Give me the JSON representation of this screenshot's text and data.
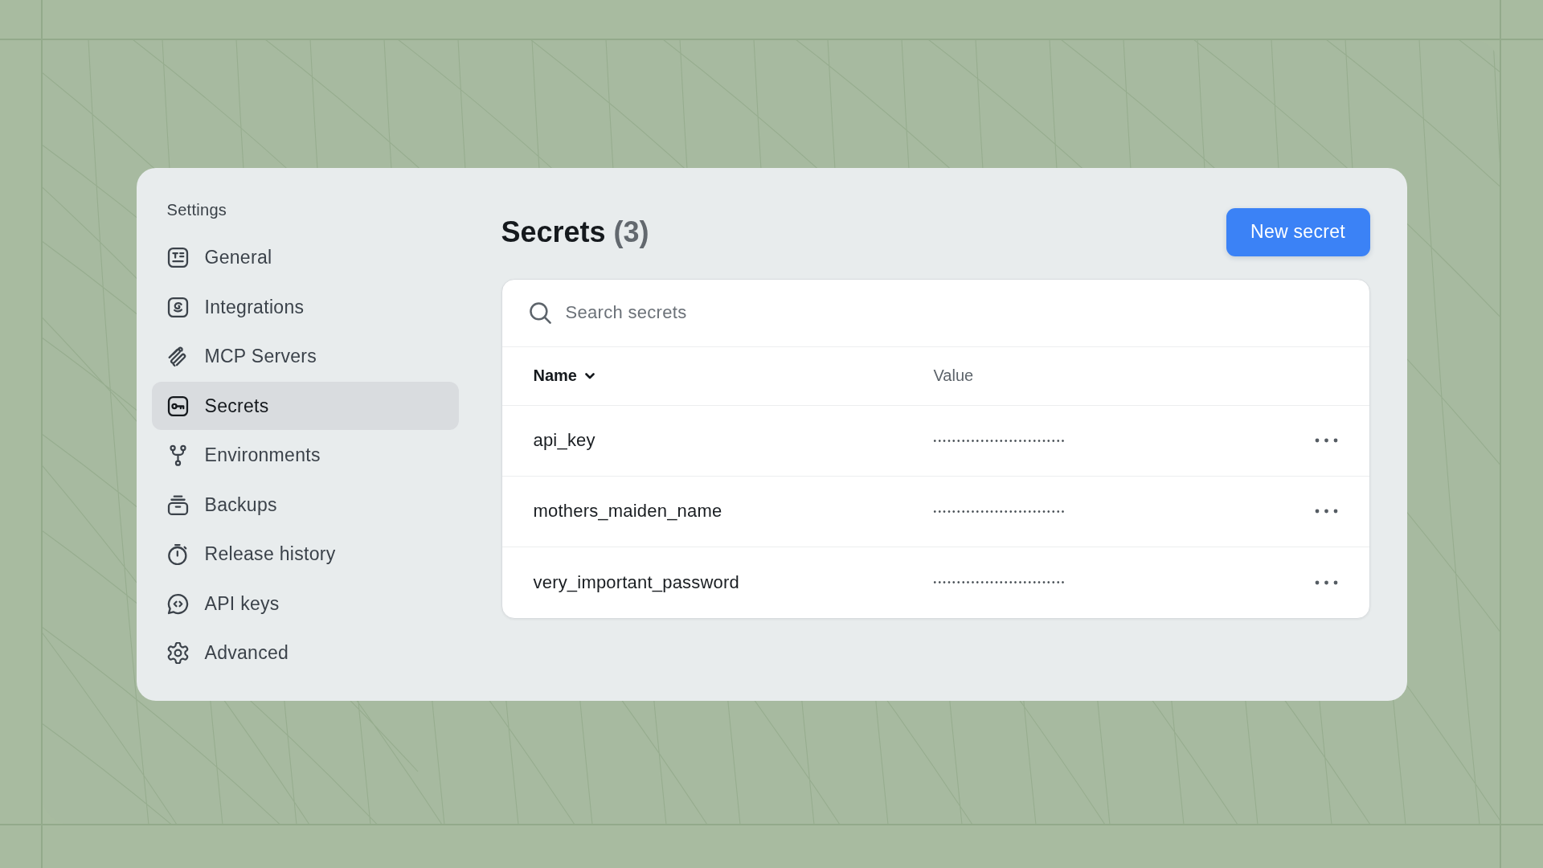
{
  "sidebar": {
    "title": "Settings",
    "items": [
      {
        "label": "General",
        "selected": false
      },
      {
        "label": "Integrations",
        "selected": false
      },
      {
        "label": "MCP Servers",
        "selected": false
      },
      {
        "label": "Secrets",
        "selected": true
      },
      {
        "label": "Environments",
        "selected": false
      },
      {
        "label": "Backups",
        "selected": false
      },
      {
        "label": "Release history",
        "selected": false
      },
      {
        "label": "API keys",
        "selected": false
      },
      {
        "label": "Advanced",
        "selected": false
      }
    ]
  },
  "header": {
    "title": "Secrets",
    "count": "(3)",
    "button": "New secret"
  },
  "search": {
    "placeholder": "Search secrets"
  },
  "table": {
    "columns": [
      {
        "label": "Name",
        "kind": "sort"
      },
      {
        "label": "Value",
        "kind": "plain"
      }
    ],
    "rows": [
      {
        "name": "api_key",
        "value": "••••••••••••••••••••••••••••"
      },
      {
        "name": "mothers_maiden_name",
        "value": "••••••••••••••••••••••••••••"
      },
      {
        "name": "very_important_password",
        "value": "••••••••••••••••••••••••••••"
      }
    ]
  }
}
